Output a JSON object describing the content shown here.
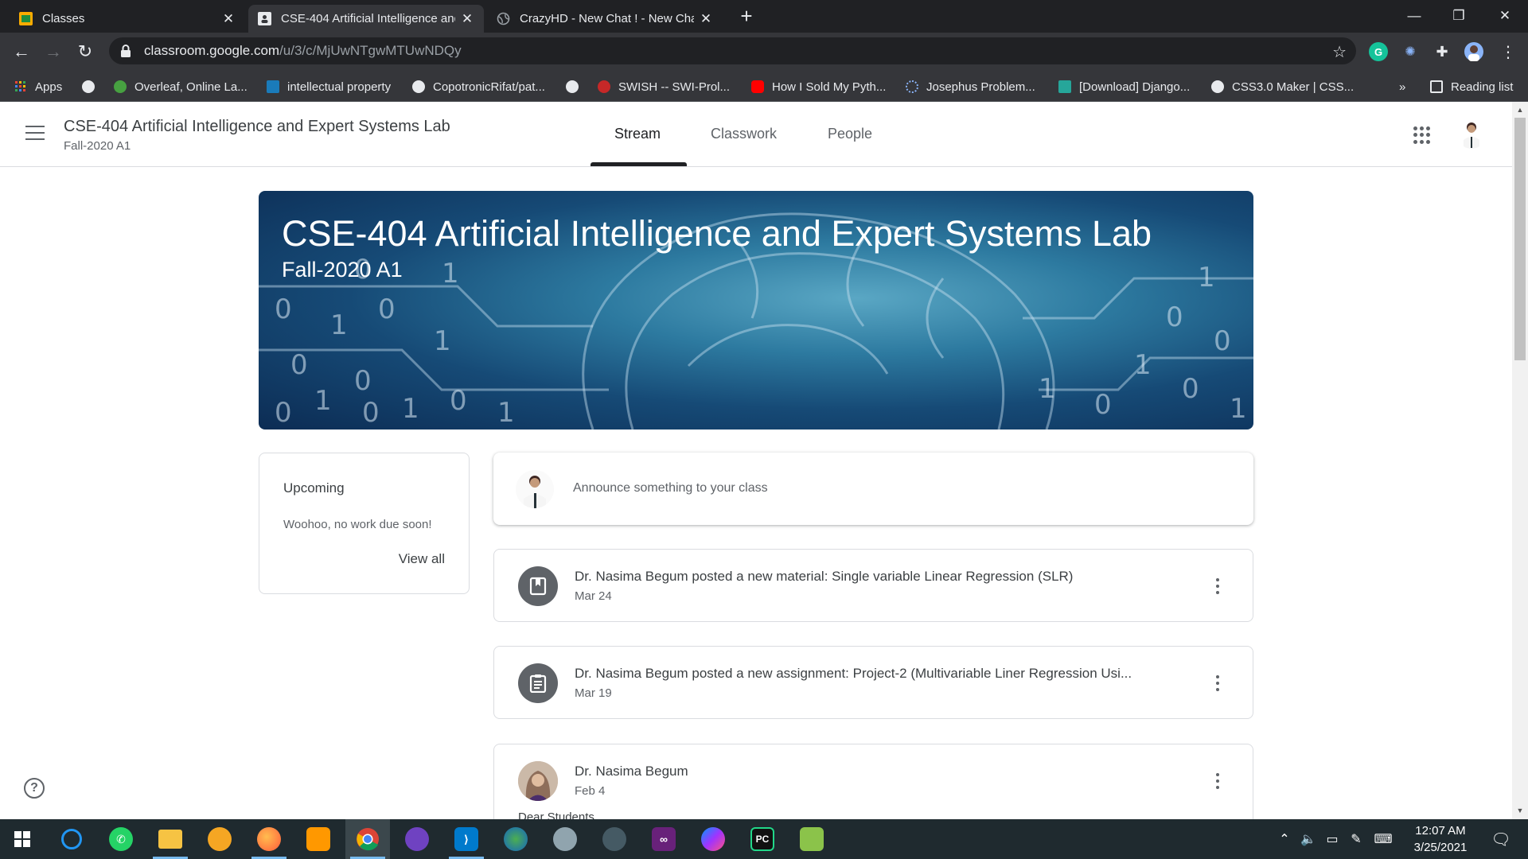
{
  "browser": {
    "tabs": [
      {
        "title": "Classes",
        "icon": "classroom-icon"
      },
      {
        "title": "CSE-404 Artificial Intelligence and",
        "icon": "classroom-class-icon"
      },
      {
        "title": "CrazyHD - New Chat ! - New Cha",
        "icon": "globe-icon"
      }
    ],
    "url_host": "classroom.google.com",
    "url_path": "/u/3/c/MjUwNTgwMTUwNDQy",
    "bookmarks": [
      {
        "label": "Apps",
        "icon": "apps-grid-icon"
      },
      {
        "label": "",
        "icon": "globe-icon"
      },
      {
        "label": "Overleaf, Online La...",
        "icon": "overleaf-icon"
      },
      {
        "label": "intellectual property",
        "icon": "scribd-icon"
      },
      {
        "label": "CopotronicRifat/pat...",
        "icon": "github-icon"
      },
      {
        "label": "",
        "icon": "globe-icon"
      },
      {
        "label": "SWISH -- SWI-Prol...",
        "icon": "swish-icon"
      },
      {
        "label": "How I Sold My Pyth...",
        "icon": "youtube-icon"
      },
      {
        "label": "Josephus Problem...",
        "icon": "loading-icon"
      },
      {
        "label": "[Download] Django...",
        "icon": "download-site-icon"
      },
      {
        "label": "CSS3.0 Maker | CSS...",
        "icon": "globe-icon"
      }
    ],
    "overflow": "»",
    "reading_list": "Reading list"
  },
  "header": {
    "class_name": "CSE-404 Artificial Intelligence and Expert Systems Lab",
    "section": "Fall-2020 A1",
    "tabs": [
      "Stream",
      "Classwork",
      "People"
    ],
    "active_tab": "Stream"
  },
  "banner": {
    "title": "CSE-404 Artificial Intelligence and Expert Systems Lab",
    "subtitle": "Fall-2020 A1"
  },
  "upcoming": {
    "heading": "Upcoming",
    "text": "Woohoo, no work due soon!",
    "view_all": "View all"
  },
  "announce": {
    "placeholder": "Announce something to your class"
  },
  "posts": [
    {
      "title": "Dr. Nasima Begum posted a new material: Single variable Linear Regression (SLR)",
      "date": "Mar 24",
      "icon": "material-icon"
    },
    {
      "title": "Dr. Nasima Begum posted a new assignment: Project-2 (Multivariable Liner Regression Usi...",
      "date": "Mar 19",
      "icon": "assignment-icon"
    },
    {
      "title": "Dr. Nasima Begum",
      "date": "Feb 4",
      "body": "Dear Students,"
    }
  ],
  "taskbar": {
    "time": "12:07 AM",
    "date": "3/25/2021"
  },
  "colors": {
    "chrome_dark": "#202124",
    "chrome_toolbar": "#35363a",
    "classroom_text": "#3c4043",
    "taskbar": "#1f2a2f"
  }
}
